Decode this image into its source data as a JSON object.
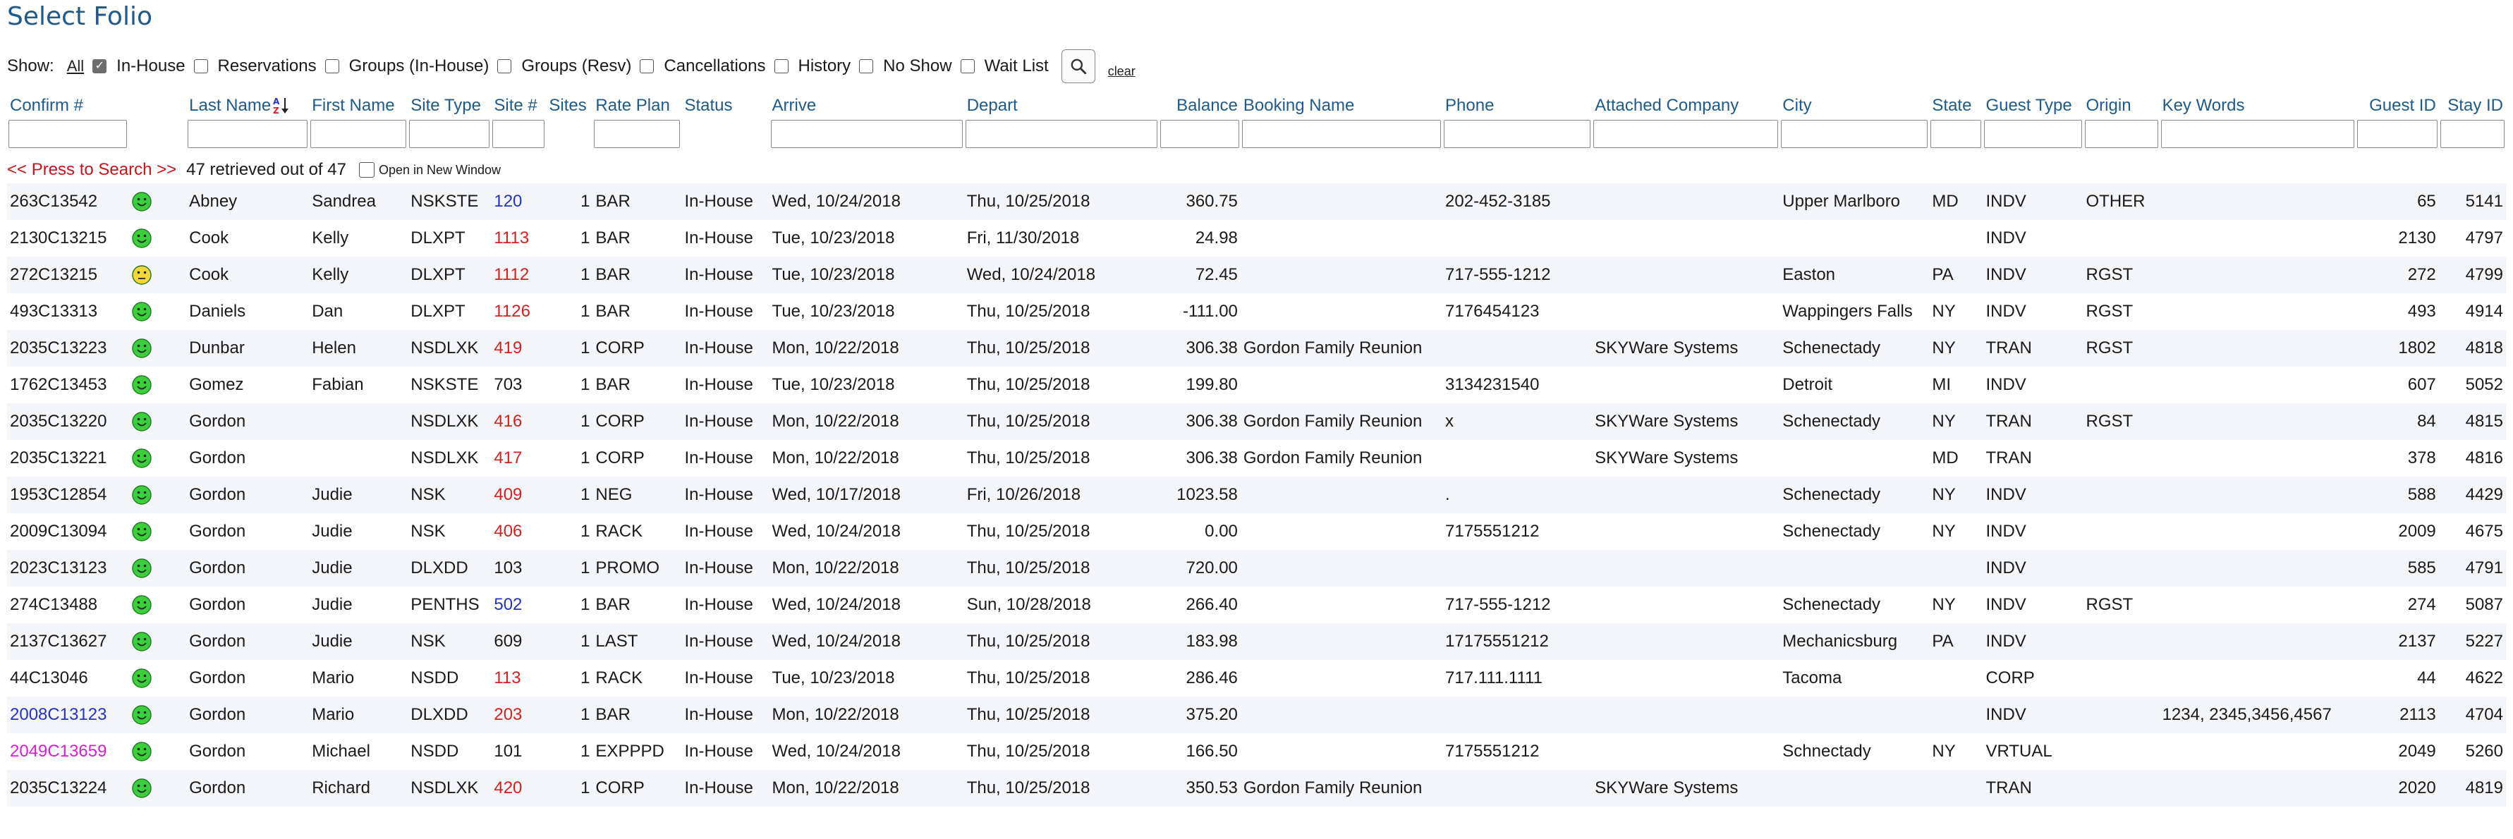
{
  "page": {
    "title": "Select Folio"
  },
  "filters": {
    "show_label": "Show:",
    "all_label": "All",
    "options": [
      {
        "label": "In-House",
        "checked": true
      },
      {
        "label": "Reservations",
        "checked": false
      },
      {
        "label": "Groups (In-House)",
        "checked": false
      },
      {
        "label": "Groups (Resv)",
        "checked": false
      },
      {
        "label": "Cancellations",
        "checked": false
      },
      {
        "label": "History",
        "checked": false
      },
      {
        "label": "No Show",
        "checked": false
      },
      {
        "label": "Wait List",
        "checked": false
      }
    ],
    "clear_label": "clear"
  },
  "columns": [
    {
      "key": "confirm",
      "label": "Confirm #"
    },
    {
      "key": "face",
      "label": ""
    },
    {
      "key": "last",
      "label": "Last Name"
    },
    {
      "key": "first",
      "label": "First Name"
    },
    {
      "key": "sitetype",
      "label": "Site Type"
    },
    {
      "key": "site",
      "label": "Site #"
    },
    {
      "key": "sites",
      "label": "Sites"
    },
    {
      "key": "rate",
      "label": "Rate Plan"
    },
    {
      "key": "status",
      "label": "Status"
    },
    {
      "key": "arrive",
      "label": "Arrive"
    },
    {
      "key": "depart",
      "label": "Depart"
    },
    {
      "key": "balance",
      "label": "Balance"
    },
    {
      "key": "booking",
      "label": "Booking Name"
    },
    {
      "key": "phone",
      "label": "Phone"
    },
    {
      "key": "company",
      "label": "Attached Company"
    },
    {
      "key": "city",
      "label": "City"
    },
    {
      "key": "state",
      "label": "State"
    },
    {
      "key": "guesttype",
      "label": "Guest Type"
    },
    {
      "key": "origin",
      "label": "Origin"
    },
    {
      "key": "keywords",
      "label": "Key Words"
    },
    {
      "key": "guestid",
      "label": "Guest ID"
    },
    {
      "key": "stayid",
      "label": "Stay ID"
    }
  ],
  "search": {
    "press_label": "<< Press to Search >>",
    "retrieved_text": "47 retrieved out of 47",
    "new_window_label": "Open in New Window"
  },
  "colors": {
    "accent": "#1f5a8c",
    "red": "#d6201f",
    "blue": "#2333c4",
    "magenta": "#d81ed8",
    "face_green": "#3bd03b",
    "face_yellow": "#f2d63a"
  },
  "rows": [
    {
      "confirm": "263C13542",
      "confirm_color": "",
      "face": "happy",
      "last": "Abney",
      "first": "Sandrea",
      "sitetype": "NSKSTE",
      "site": "120",
      "site_color": "blue",
      "sites": "1",
      "rate": "BAR",
      "status": "In-House",
      "arrive": "Wed, 10/24/2018",
      "depart": "Thu, 10/25/2018",
      "balance": "360.75",
      "booking": "",
      "phone": "202-452-3185",
      "company": "",
      "city": "Upper Marlboro",
      "state": "MD",
      "guesttype": "INDV",
      "origin": "OTHER",
      "keywords": "",
      "guestid": "65",
      "stayid": "5141"
    },
    {
      "confirm": "2130C13215",
      "confirm_color": "",
      "face": "happy",
      "last": "Cook",
      "first": "Kelly",
      "sitetype": "DLXPT",
      "site": "1113",
      "site_color": "red",
      "sites": "1",
      "rate": "BAR",
      "status": "In-House",
      "arrive": "Tue, 10/23/2018",
      "depart": "Fri, 11/30/2018",
      "balance": "24.98",
      "booking": "",
      "phone": "",
      "company": "",
      "city": "",
      "state": "",
      "guesttype": "INDV",
      "origin": "",
      "keywords": "",
      "guestid": "2130",
      "stayid": "4797"
    },
    {
      "confirm": "272C13215",
      "confirm_color": "",
      "face": "neutral",
      "last": "Cook",
      "first": "Kelly",
      "sitetype": "DLXPT",
      "site": "1112",
      "site_color": "red",
      "sites": "1",
      "rate": "BAR",
      "status": "In-House",
      "arrive": "Tue, 10/23/2018",
      "depart": "Wed, 10/24/2018",
      "balance": "72.45",
      "booking": "",
      "phone": "717-555-1212",
      "company": "",
      "city": "Easton",
      "state": "PA",
      "guesttype": "INDV",
      "origin": "RGST",
      "keywords": "",
      "guestid": "272",
      "stayid": "4799"
    },
    {
      "confirm": "493C13313",
      "confirm_color": "",
      "face": "happy",
      "last": "Daniels",
      "first": "Dan",
      "sitetype": "DLXPT",
      "site": "1126",
      "site_color": "red",
      "sites": "1",
      "rate": "BAR",
      "status": "In-House",
      "arrive": "Tue, 10/23/2018",
      "depart": "Thu, 10/25/2018",
      "balance": "-111.00",
      "booking": "",
      "phone": "7176454123",
      "company": "",
      "city": "Wappingers Falls",
      "state": "NY",
      "guesttype": "INDV",
      "origin": "RGST",
      "keywords": "",
      "guestid": "493",
      "stayid": "4914"
    },
    {
      "confirm": "2035C13223",
      "confirm_color": "",
      "face": "happy",
      "last": "Dunbar",
      "first": "Helen",
      "sitetype": "NSDLXK",
      "site": "419",
      "site_color": "red",
      "sites": "1",
      "rate": "CORP",
      "status": "In-House",
      "arrive": "Mon, 10/22/2018",
      "depart": "Thu, 10/25/2018",
      "balance": "306.38",
      "booking": "Gordon Family Reunion",
      "phone": "",
      "company": "SKYWare Systems",
      "city": "Schenectady",
      "state": "NY",
      "guesttype": "TRAN",
      "origin": "RGST",
      "keywords": "",
      "guestid": "1802",
      "stayid": "4818"
    },
    {
      "confirm": "1762C13453",
      "confirm_color": "",
      "face": "happy",
      "last": "Gomez",
      "first": "Fabian",
      "sitetype": "NSKSTE",
      "site": "703",
      "site_color": "",
      "sites": "1",
      "rate": "BAR",
      "status": "In-House",
      "arrive": "Tue, 10/23/2018",
      "depart": "Thu, 10/25/2018",
      "balance": "199.80",
      "booking": "",
      "phone": "3134231540",
      "company": "",
      "city": "Detroit",
      "state": "MI",
      "guesttype": "INDV",
      "origin": "",
      "keywords": "",
      "guestid": "607",
      "stayid": "5052"
    },
    {
      "confirm": "2035C13220",
      "confirm_color": "",
      "face": "happy",
      "last": "Gordon",
      "first": "",
      "sitetype": "NSDLXK",
      "site": "416",
      "site_color": "red",
      "sites": "1",
      "rate": "CORP",
      "status": "In-House",
      "arrive": "Mon, 10/22/2018",
      "depart": "Thu, 10/25/2018",
      "balance": "306.38",
      "booking": "Gordon Family Reunion",
      "phone": "x",
      "company": "SKYWare Systems",
      "city": "Schenectady",
      "state": "NY",
      "guesttype": "TRAN",
      "origin": "RGST",
      "keywords": "",
      "guestid": "84",
      "stayid": "4815"
    },
    {
      "confirm": "2035C13221",
      "confirm_color": "",
      "face": "happy",
      "last": "Gordon",
      "first": "",
      "sitetype": "NSDLXK",
      "site": "417",
      "site_color": "red",
      "sites": "1",
      "rate": "CORP",
      "status": "In-House",
      "arrive": "Mon, 10/22/2018",
      "depart": "Thu, 10/25/2018",
      "balance": "306.38",
      "booking": "Gordon Family Reunion",
      "phone": "",
      "company": "SKYWare Systems",
      "city": "",
      "state": "MD",
      "guesttype": "TRAN",
      "origin": "",
      "keywords": "",
      "guestid": "378",
      "stayid": "4816"
    },
    {
      "confirm": "1953C12854",
      "confirm_color": "",
      "face": "happy",
      "last": "Gordon",
      "first": "Judie",
      "sitetype": "NSK",
      "site": "409",
      "site_color": "red",
      "sites": "1",
      "rate": "NEG",
      "status": "In-House",
      "arrive": "Wed, 10/17/2018",
      "depart": "Fri, 10/26/2018",
      "balance": "1023.58",
      "booking": "",
      "phone": ".",
      "company": "",
      "city": "Schenectady",
      "state": "NY",
      "guesttype": "INDV",
      "origin": "",
      "keywords": "",
      "guestid": "588",
      "stayid": "4429"
    },
    {
      "confirm": "2009C13094",
      "confirm_color": "",
      "face": "happy",
      "last": "Gordon",
      "first": "Judie",
      "sitetype": "NSK",
      "site": "406",
      "site_color": "red",
      "sites": "1",
      "rate": "RACK",
      "status": "In-House",
      "arrive": "Wed, 10/24/2018",
      "depart": "Thu, 10/25/2018",
      "balance": "0.00",
      "booking": "",
      "phone": "7175551212",
      "company": "",
      "city": "Schenectady",
      "state": "NY",
      "guesttype": "INDV",
      "origin": "",
      "keywords": "",
      "guestid": "2009",
      "stayid": "4675"
    },
    {
      "confirm": "2023C13123",
      "confirm_color": "",
      "face": "happy",
      "last": "Gordon",
      "first": "Judie",
      "sitetype": "DLXDD",
      "site": "103",
      "site_color": "",
      "sites": "1",
      "rate": "PROMO",
      "status": "In-House",
      "arrive": "Mon, 10/22/2018",
      "depart": "Thu, 10/25/2018",
      "balance": "720.00",
      "booking": "",
      "phone": "",
      "company": "",
      "city": "",
      "state": "",
      "guesttype": "INDV",
      "origin": "",
      "keywords": "",
      "guestid": "585",
      "stayid": "4791"
    },
    {
      "confirm": "274C13488",
      "confirm_color": "",
      "face": "happy",
      "last": "Gordon",
      "first": "Judie",
      "sitetype": "PENTHS",
      "site": "502",
      "site_color": "blue",
      "sites": "1",
      "rate": "BAR",
      "status": "In-House",
      "arrive": "Wed, 10/24/2018",
      "depart": "Sun, 10/28/2018",
      "balance": "266.40",
      "booking": "",
      "phone": "717-555-1212",
      "company": "",
      "city": "Schenectady",
      "state": "NY",
      "guesttype": "INDV",
      "origin": "RGST",
      "keywords": "",
      "guestid": "274",
      "stayid": "5087"
    },
    {
      "confirm": "2137C13627",
      "confirm_color": "",
      "face": "happy",
      "last": "Gordon",
      "first": "Judie",
      "sitetype": "NSK",
      "site": "609",
      "site_color": "",
      "sites": "1",
      "rate": "LAST",
      "status": "In-House",
      "arrive": "Wed, 10/24/2018",
      "depart": "Thu, 10/25/2018",
      "balance": "183.98",
      "booking": "",
      "phone": "17175551212",
      "company": "",
      "city": "Mechanicsburg",
      "state": "PA",
      "guesttype": "INDV",
      "origin": "",
      "keywords": "",
      "guestid": "2137",
      "stayid": "5227"
    },
    {
      "confirm": "44C13046",
      "confirm_color": "",
      "face": "happy",
      "last": "Gordon",
      "first": "Mario",
      "sitetype": "NSDD",
      "site": "113",
      "site_color": "red",
      "sites": "1",
      "rate": "RACK",
      "status": "In-House",
      "arrive": "Tue, 10/23/2018",
      "depart": "Thu, 10/25/2018",
      "balance": "286.46",
      "booking": "",
      "phone": "717.111.1111",
      "company": "",
      "city": "Tacoma",
      "state": "",
      "guesttype": "CORP",
      "origin": "",
      "keywords": "",
      "guestid": "44",
      "stayid": "4622"
    },
    {
      "confirm": "2008C13123",
      "confirm_color": "blue",
      "face": "happy",
      "last": "Gordon",
      "first": "Mario",
      "sitetype": "DLXDD",
      "site": "203",
      "site_color": "red",
      "sites": "1",
      "rate": "BAR",
      "status": "In-House",
      "arrive": "Mon, 10/22/2018",
      "depart": "Thu, 10/25/2018",
      "balance": "375.20",
      "booking": "",
      "phone": "",
      "company": "",
      "city": "",
      "state": "",
      "guesttype": "INDV",
      "origin": "",
      "keywords": "1234, 2345,3456,4567",
      "guestid": "2113",
      "stayid": "4704"
    },
    {
      "confirm": "2049C13659",
      "confirm_color": "magenta",
      "face": "happy",
      "last": "Gordon",
      "first": "Michael",
      "sitetype": "NSDD",
      "site": "101",
      "site_color": "",
      "sites": "1",
      "rate": "EXPPPD",
      "status": "In-House",
      "arrive": "Wed, 10/24/2018",
      "depart": "Thu, 10/25/2018",
      "balance": "166.50",
      "booking": "",
      "phone": "7175551212",
      "company": "",
      "city": "Schnectady",
      "state": "NY",
      "guesttype": "VRTUAL",
      "origin": "",
      "keywords": "",
      "guestid": "2049",
      "stayid": "5260"
    },
    {
      "confirm": "2035C13224",
      "confirm_color": "",
      "face": "happy",
      "last": "Gordon",
      "first": "Richard",
      "sitetype": "NSDLXK",
      "site": "420",
      "site_color": "red",
      "sites": "1",
      "rate": "CORP",
      "status": "In-House",
      "arrive": "Mon, 10/22/2018",
      "depart": "Thu, 10/25/2018",
      "balance": "350.53",
      "booking": "Gordon Family Reunion",
      "phone": "",
      "company": "SKYWare Systems",
      "city": "",
      "state": "",
      "guesttype": "TRAN",
      "origin": "",
      "keywords": "",
      "guestid": "2020",
      "stayid": "4819"
    }
  ]
}
